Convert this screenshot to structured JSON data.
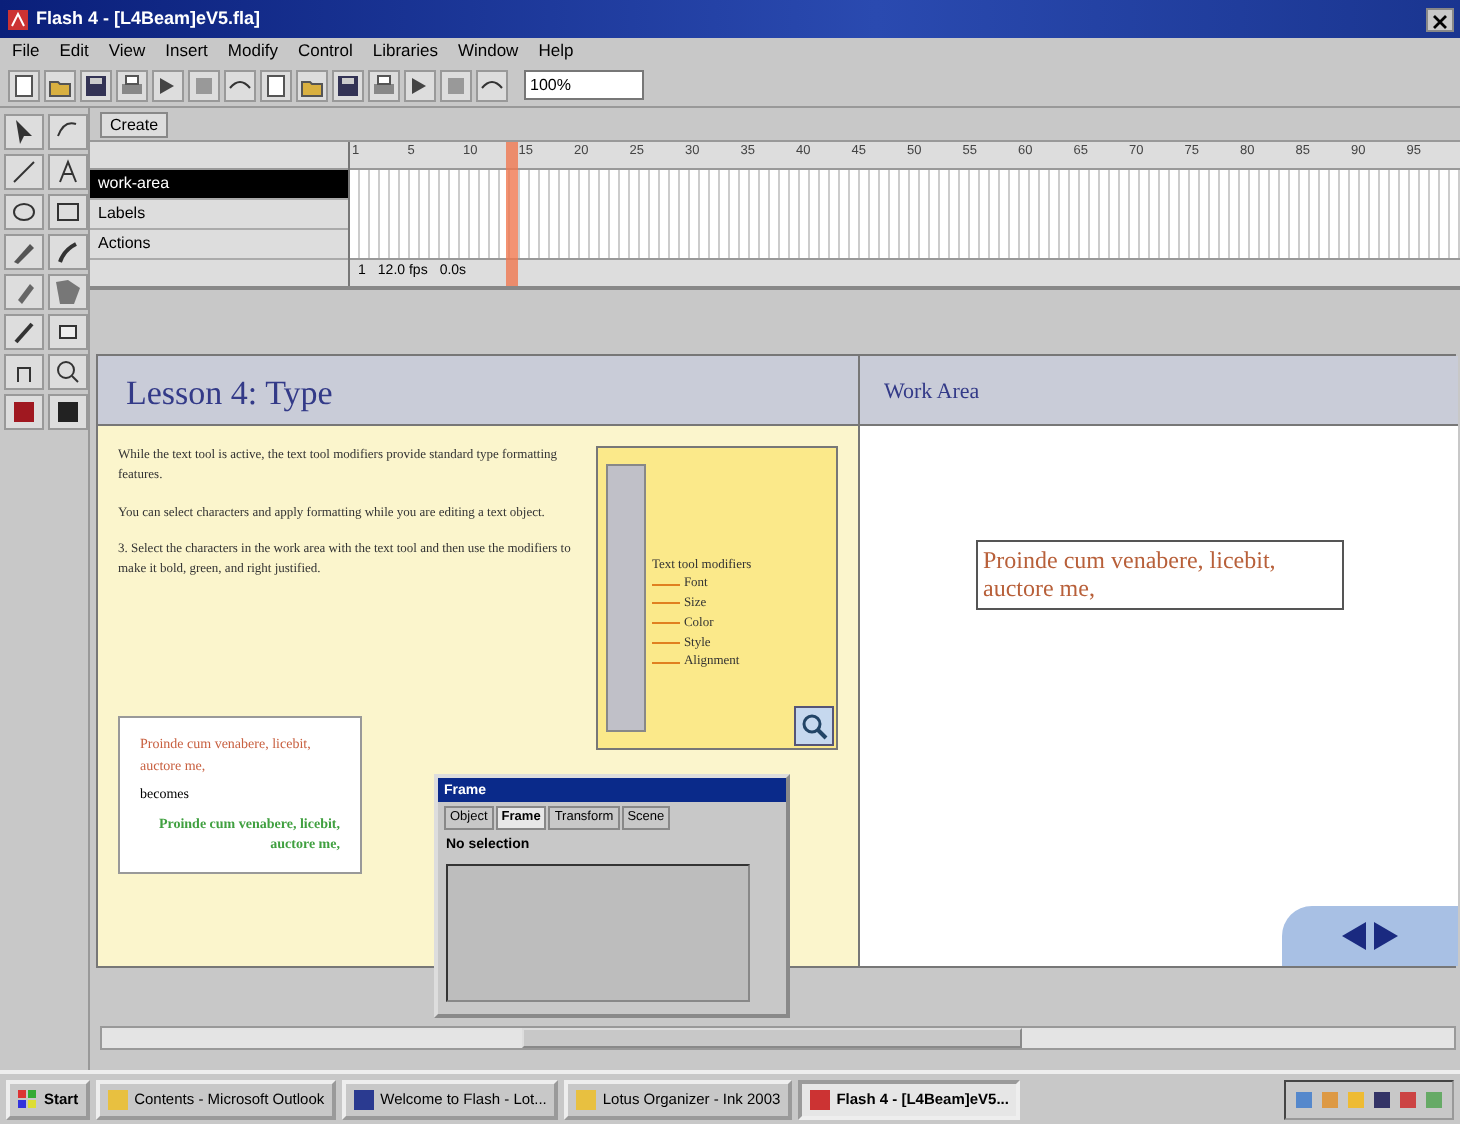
{
  "window": {
    "title": "Flash 4 - [L4Beam]eV5.fla]"
  },
  "menu": [
    "File",
    "Edit",
    "View",
    "Insert",
    "Modify",
    "Control",
    "Libraries",
    "Window",
    "Help"
  ],
  "toolbar": {
    "zoom": "100%"
  },
  "scene": {
    "label": "Create"
  },
  "timeline": {
    "ruler": [
      "1",
      "5",
      "10",
      "15",
      "20",
      "25",
      "30",
      "35",
      "40",
      "45",
      "50",
      "55",
      "60",
      "65",
      "70",
      "75",
      "80",
      "85",
      "90",
      "95"
    ],
    "layers": [
      {
        "name": "work-area",
        "selected": true
      },
      {
        "name": "Labels",
        "selected": false
      },
      {
        "name": "Actions",
        "selected": false
      }
    ],
    "status": [
      "1",
      "12.0 fps",
      "0.0s"
    ]
  },
  "lesson": {
    "title": "Lesson 4: Type",
    "paragraphs": [
      "While the text tool is active, the text tool modifiers provide standard type formatting features.",
      "You can select characters and apply formatting while you are editing a text object.",
      "3. Select the characters in the work area with the text tool and then use the modifiers to make it bold, green, and right justified."
    ],
    "callout": {
      "title": "Text tool modifiers",
      "items": [
        "Font",
        "Size",
        "Color",
        "Style",
        "Alignment"
      ]
    },
    "sample": {
      "before": "Proinde cum venabere, licebit, auctore me,",
      "middle": "becomes",
      "after": "Proinde cum venabere, licebit, auctore me,"
    }
  },
  "work_area": {
    "title": "Work Area",
    "text": "Proinde cum venabere, licebit, auctore me,"
  },
  "inspector": {
    "title": "Frame",
    "tabs": [
      {
        "label": "Object",
        "selected": false
      },
      {
        "label": "Frame",
        "selected": true
      },
      {
        "label": "Transform",
        "selected": false
      },
      {
        "label": "Scene",
        "selected": false
      }
    ],
    "message": "No selection"
  },
  "taskbar": {
    "start": "Start",
    "tasks": [
      {
        "label": "Contents - Microsoft Outlook",
        "selected": false
      },
      {
        "label": "Welcome to Flash - Lot...",
        "selected": false
      },
      {
        "label": "Lotus Organizer - Ink 2003",
        "selected": false
      },
      {
        "label": "Flash 4 - [L4Beam]eV5...",
        "selected": true
      }
    ]
  }
}
